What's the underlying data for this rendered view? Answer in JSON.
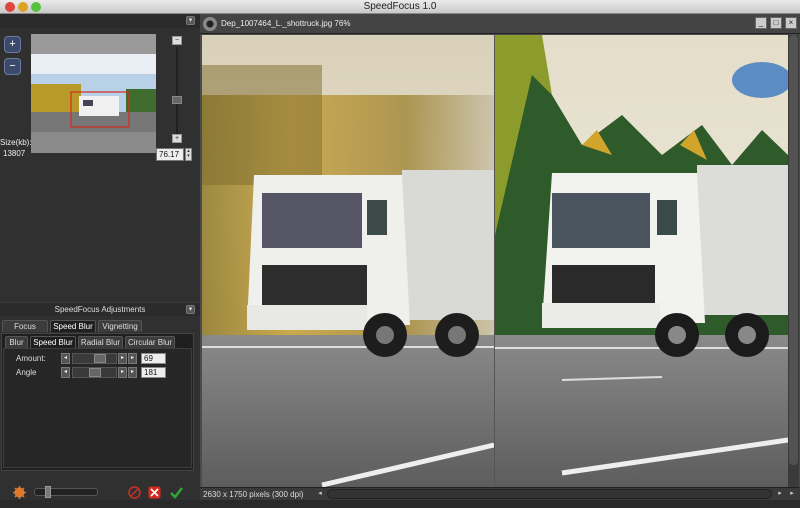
{
  "app": {
    "title": "SpeedFocus 1.0"
  },
  "navigator": {
    "size_label": "Size(kb):",
    "size_value": "13807",
    "zoom_value": "76.17"
  },
  "adjustments": {
    "title": "SpeedFocus Adjustments",
    "main_tabs": [
      {
        "label": "Focus Areas",
        "active": false
      },
      {
        "label": "Speed Blur",
        "active": true
      },
      {
        "label": "Vignetting",
        "active": false
      }
    ],
    "sub_tabs": [
      {
        "label": "Blur",
        "active": false
      },
      {
        "label": "Speed Blur",
        "active": true
      },
      {
        "label": "Radial Blur",
        "active": false
      },
      {
        "label": "Circular Blur",
        "active": false
      }
    ],
    "params": [
      {
        "label": "Amount:",
        "value": "69",
        "level": 0.69
      },
      {
        "label": "Angle",
        "value": "181",
        "level": 0.5
      }
    ]
  },
  "document": {
    "title": "Dep_1007464_L._shottruck.jpg 76%",
    "status": "2630 x 1750 pixels (300 dpi)"
  },
  "icons": {
    "zoom_in": "zoom-in-icon",
    "zoom_out": "zoom-out-icon",
    "settings": "gear-icon",
    "cancel": "cancel-icon",
    "reset": "reset-icon",
    "apply": "checkmark-icon"
  },
  "colors": {
    "accent_red": "#d32c1f",
    "apply_green": "#2fa62f"
  }
}
